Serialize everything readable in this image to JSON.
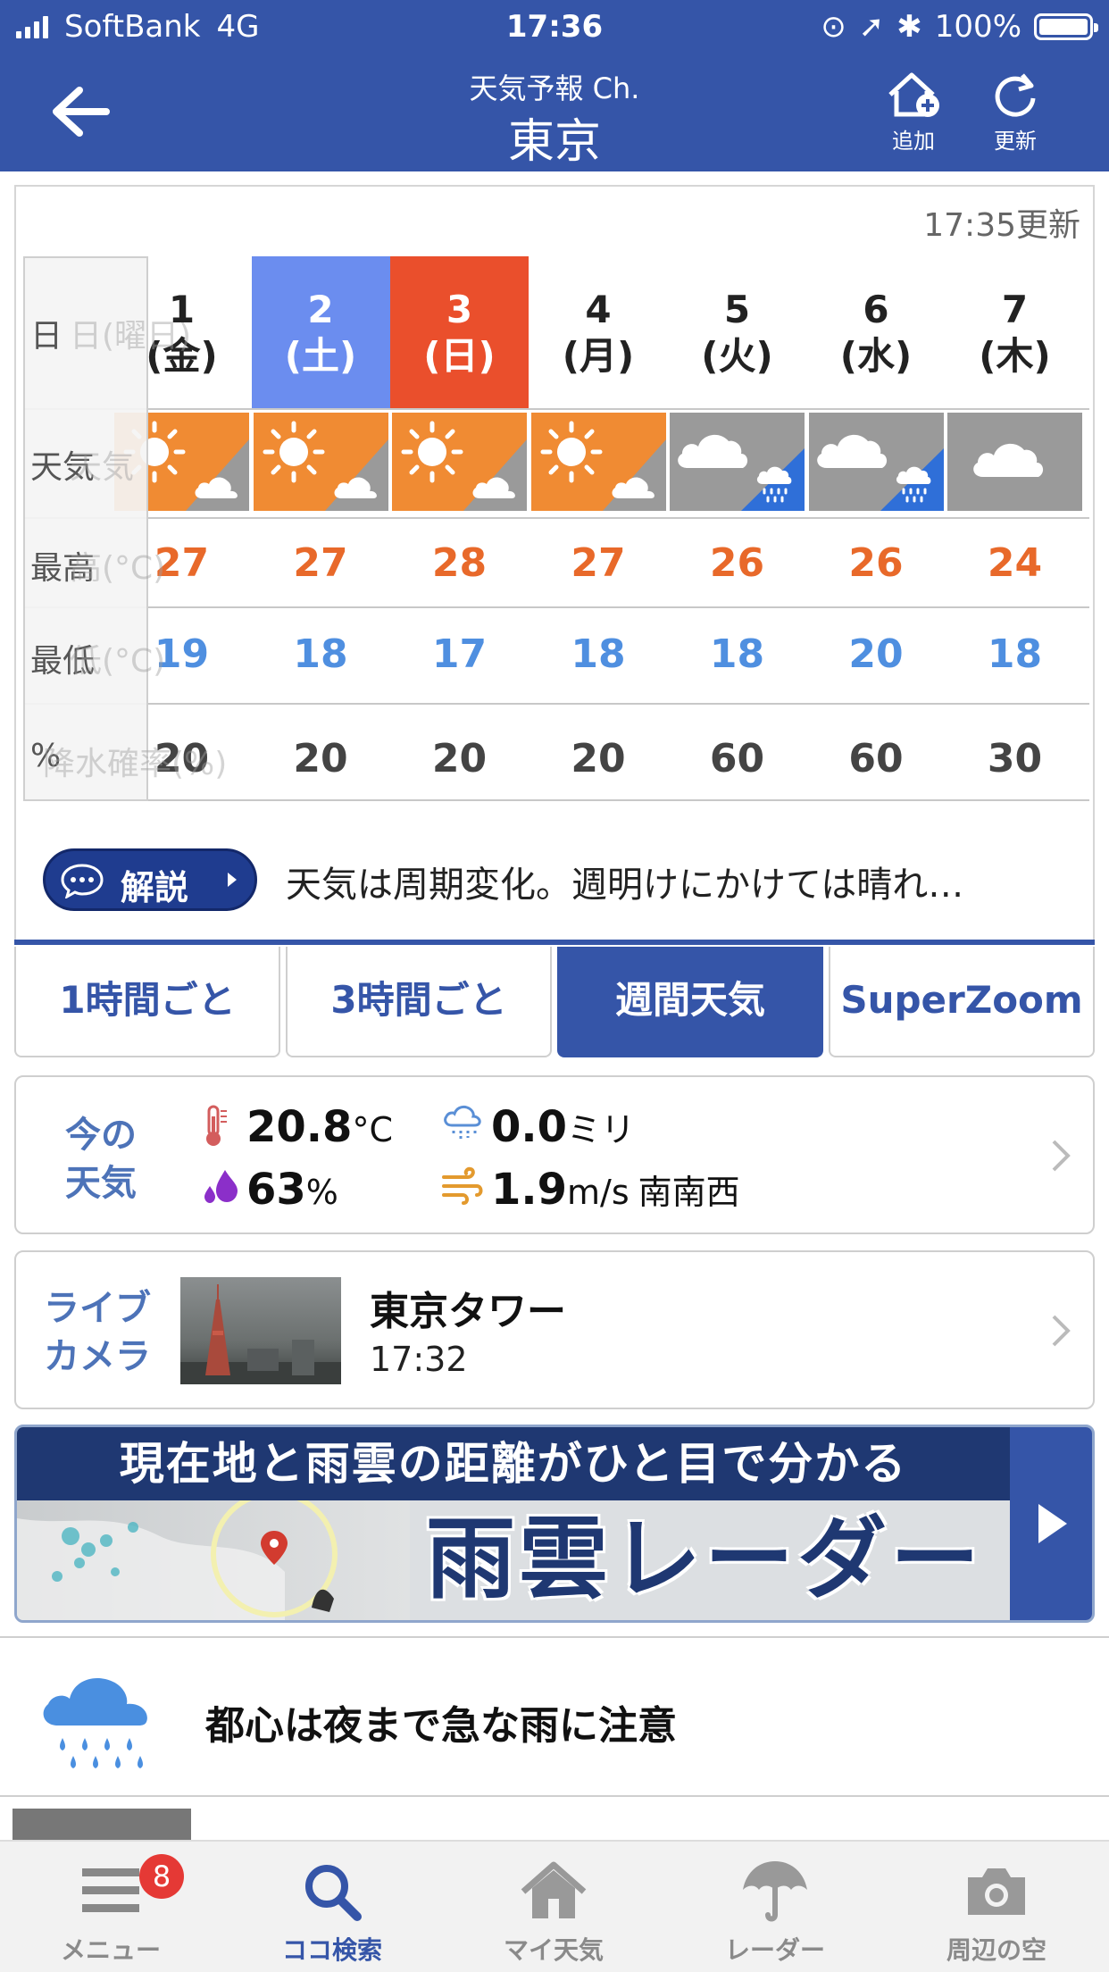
{
  "status_bar": {
    "carrier": "SoftBank",
    "network": "4G",
    "time": "17:36",
    "battery": "100%"
  },
  "header": {
    "subtitle": "天気予報 Ch.",
    "title": "東京",
    "add_label": "追加",
    "refresh_label": "更新"
  },
  "forecast": {
    "updated": "17:35更新",
    "row_labels": {
      "date": "日",
      "weather": "天気",
      "high": "最高",
      "low": "最低",
      "precip": "%"
    },
    "ghost_labels": {
      "date": "日(曜日)",
      "weather": "天気",
      "high": "高(°C)",
      "low": "低(°C)",
      "precip": "降水確率(%)"
    },
    "days": [
      {
        "day": "1",
        "weekday": "(金)",
        "icon": "sunny-then-cloudy",
        "high": "27",
        "low": "19",
        "precip": "20",
        "type": "weekday"
      },
      {
        "day": "2",
        "weekday": "(土)",
        "icon": "sunny-then-cloudy",
        "high": "27",
        "low": "18",
        "precip": "20",
        "type": "sat"
      },
      {
        "day": "3",
        "weekday": "(日)",
        "icon": "sunny-then-cloudy",
        "high": "28",
        "low": "17",
        "precip": "20",
        "type": "sun"
      },
      {
        "day": "4",
        "weekday": "(月)",
        "icon": "sunny-then-cloudy",
        "high": "27",
        "low": "18",
        "precip": "20",
        "type": "weekday"
      },
      {
        "day": "5",
        "weekday": "(火)",
        "icon": "cloudy-then-rain",
        "high": "26",
        "low": "18",
        "precip": "60",
        "type": "weekday"
      },
      {
        "day": "6",
        "weekday": "(水)",
        "icon": "cloudy-then-rain",
        "high": "26",
        "low": "20",
        "precip": "60",
        "type": "weekday"
      },
      {
        "day": "7",
        "weekday": "(木)",
        "icon": "cloudy",
        "high": "24",
        "low": "18",
        "precip": "30",
        "type": "weekday"
      }
    ],
    "commentary_label": "解説",
    "commentary_text": "天気は周期変化。週明けにかけては晴れ…"
  },
  "tabs": [
    "1時間ごと",
    "3時間ごと",
    "週間天気",
    "SuperZoom"
  ],
  "active_tab": 2,
  "current": {
    "label_line1": "今の",
    "label_line2": "天気",
    "temp": "20.8",
    "temp_unit": "°C",
    "rain": "0.0",
    "rain_unit": "ミリ",
    "humidity": "63",
    "humidity_unit": "%",
    "wind": "1.9",
    "wind_unit": "m/s",
    "wind_dir": "南南西"
  },
  "live_camera": {
    "label_line1": "ライブ",
    "label_line2": "カメラ",
    "title": "東京タワー",
    "time": "17:32"
  },
  "banner": {
    "top_text": "現在地と雨雲の距離がひと目で分かる",
    "big_text": "雨雲レーダー"
  },
  "news": {
    "text": "都心は夜まで急な雨に注意"
  },
  "bottom_nav": [
    {
      "label": "メニュー",
      "badge": "8"
    },
    {
      "label": "ココ検索"
    },
    {
      "label": "マイ天気"
    },
    {
      "label": "レーダー"
    },
    {
      "label": "周辺の空"
    }
  ],
  "colors": {
    "brand": "#3555a8",
    "saturday": "#6b8def",
    "sunday": "#ea4f2c",
    "high": "#e8692a",
    "low": "#4f8fe0"
  }
}
